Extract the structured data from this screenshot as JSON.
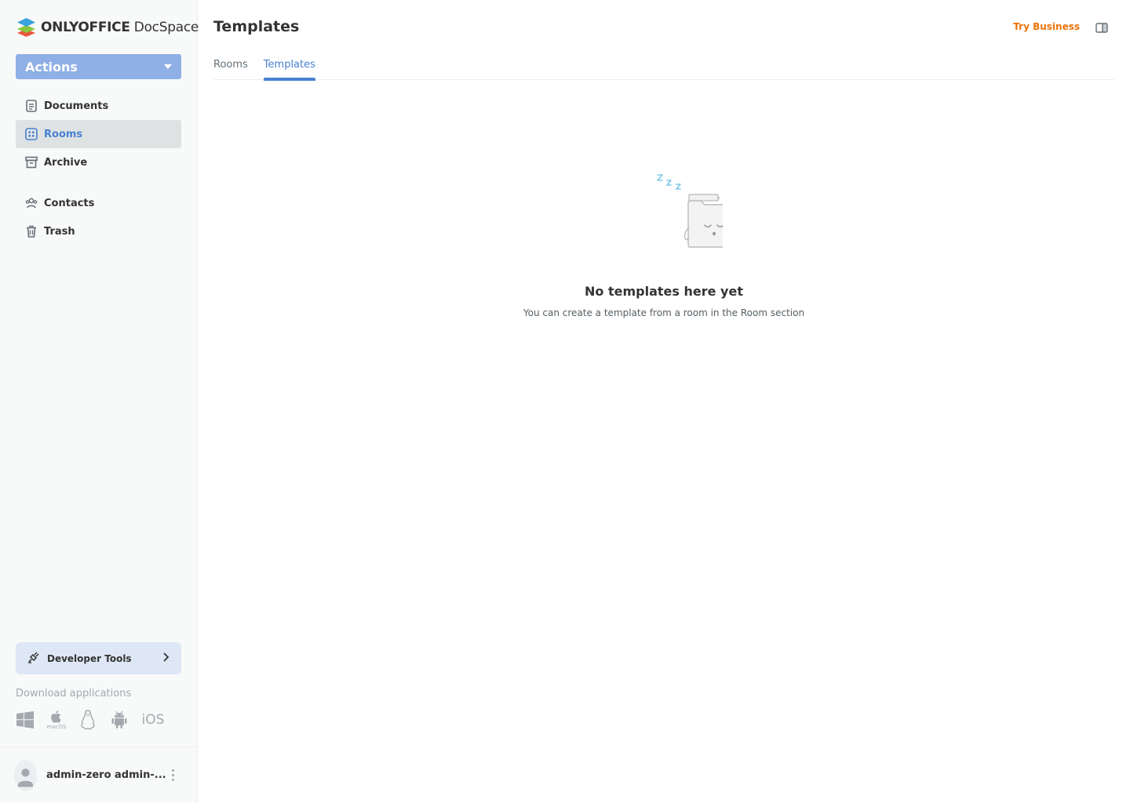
{
  "brand": {
    "name_bold": "ONLYOFFICE",
    "name_regular": "DocSpace"
  },
  "actions": {
    "label": "Actions"
  },
  "nav": {
    "primary": [
      {
        "label": "Documents",
        "icon": "document-icon"
      },
      {
        "label": "Rooms",
        "icon": "rooms-icon",
        "active": true
      },
      {
        "label": "Archive",
        "icon": "archive-icon"
      }
    ],
    "secondary": [
      {
        "label": "Contacts",
        "icon": "contacts-icon"
      },
      {
        "label": "Trash",
        "icon": "trash-icon"
      }
    ]
  },
  "developer_tools": {
    "label": "Developer Tools"
  },
  "downloads": {
    "title": "Download applications",
    "apps": [
      "windows",
      "macOS",
      "linux",
      "android",
      "iOS"
    ]
  },
  "profile": {
    "name": "admin-zero admin-..."
  },
  "header": {
    "title": "Templates",
    "try_business": "Try Business"
  },
  "tabs": [
    {
      "label": "Rooms",
      "active": false
    },
    {
      "label": "Templates",
      "active": true
    }
  ],
  "empty_state": {
    "title": "No templates here yet",
    "subtitle": "You can create a template from a room in the Room section"
  },
  "colors": {
    "accent": "#4781d1",
    "actions_button": "#8fb0e6",
    "try_business": "#ed7309",
    "sidebar_bg": "#f8f9f9"
  }
}
